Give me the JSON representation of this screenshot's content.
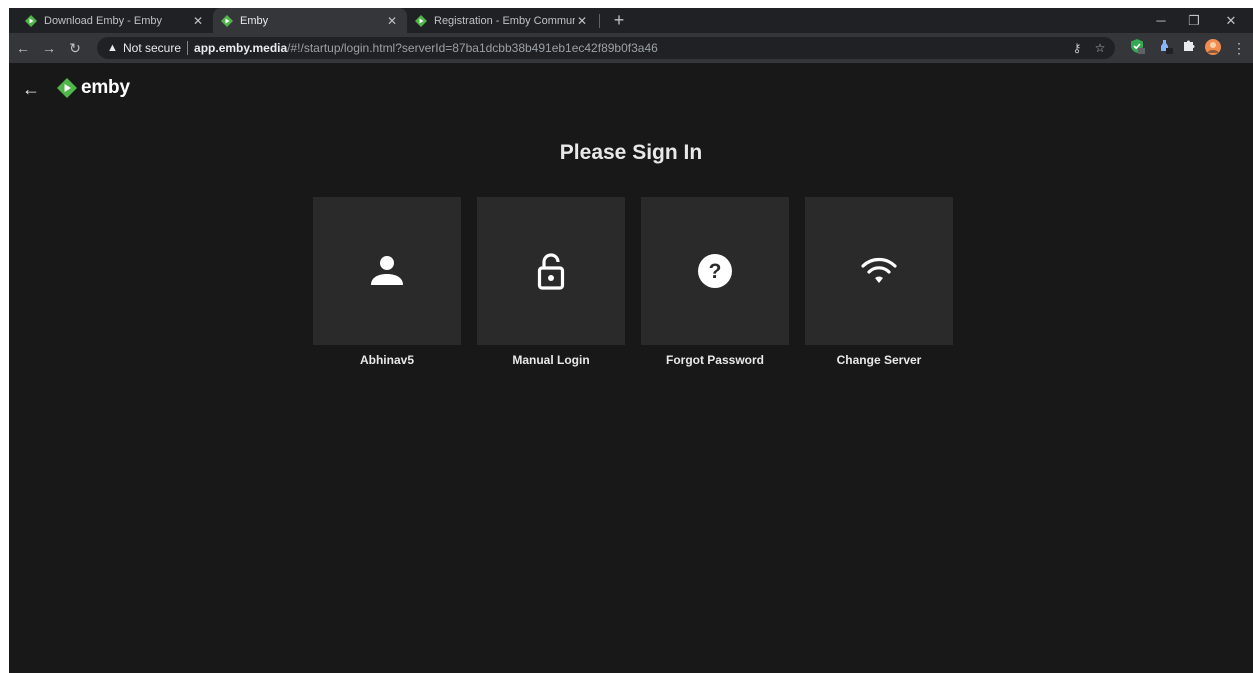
{
  "browser": {
    "tabs": [
      {
        "title": "Download Emby - Emby",
        "active": false
      },
      {
        "title": "Emby",
        "active": true
      },
      {
        "title": "Registration - Emby Community",
        "active": false
      }
    ],
    "new_tab_label": "+",
    "omnibox": {
      "security_label": "Not secure",
      "host": "app.emby.media",
      "path": "/#!/startup/login.html?serverId=87ba1dcbb38b491eb1ec42f89b0f3a46"
    },
    "extensions": [
      {
        "icon": "shield-check-icon",
        "badge": "0",
        "color": "#34a853"
      },
      {
        "icon": "bottle-icon",
        "badge": "0",
        "color": "#8ab4f8"
      },
      {
        "icon": "puzzle-icon",
        "color": "#e8eaed"
      },
      {
        "icon": "avatar-icon",
        "color": "#f28b50"
      }
    ],
    "accent": "#52b54b"
  },
  "app": {
    "logo_text": "emby",
    "heading": "Please Sign In",
    "cards": [
      {
        "label": "Abhinav5",
        "icon": "person-icon"
      },
      {
        "label": "Manual Login",
        "icon": "lock-open-icon"
      },
      {
        "label": "Forgot Password",
        "icon": "help-icon"
      },
      {
        "label": "Change Server",
        "icon": "wifi-icon"
      }
    ]
  }
}
